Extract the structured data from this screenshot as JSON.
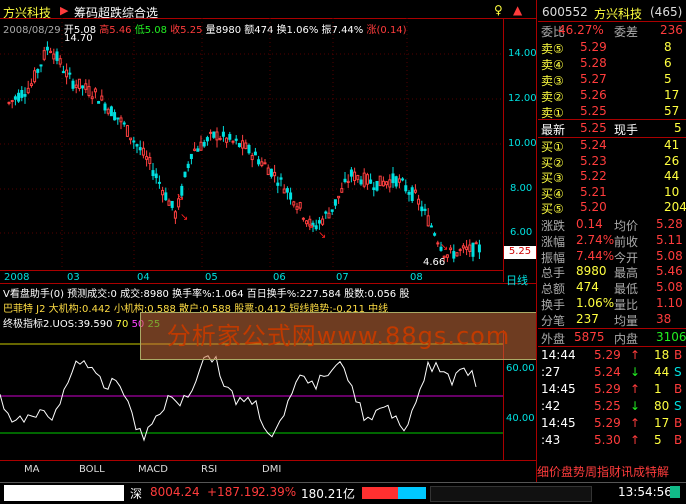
{
  "header": {
    "stock_name": "方兴科技",
    "indicator_name": "筹码超跌综合选",
    "date": "2008/08/29",
    "open": "开5.08",
    "high": "高5.46",
    "low": "低5.08",
    "close": "收5.25",
    "volume": "量8980",
    "amount": "额474",
    "turnover": "换1.06%",
    "amplitude": "振7.44%",
    "change": "涨(0.14)",
    "peak_label": "14.70"
  },
  "price_axis": [
    "14.00",
    "12.00",
    "10.00",
    "8.00",
    "6.00"
  ],
  "current_price_tag": "5.25",
  "low_label": "4.66",
  "date_axis": [
    "2008",
    "03",
    "04",
    "05",
    "06",
    "07",
    "08"
  ],
  "date_axis_right": "日线",
  "indicators": {
    "row1": "V看盘助手(0) 预测成交:0 成交:8980 换手率%:1.064 百日换手%:227.584 股数:0.056 股",
    "row2": "巴菲特 J2 大机构:0.442 小机构:0.588 散户:0.588 股票:0.412 短线趋势:-0.211 中线",
    "row3_prefix": "终极指标2.UOS:39.590",
    "row3_a": "70",
    "row3_b": "50",
    "row3_c": "25"
  },
  "osc_axis": [
    "60.00",
    "40.00"
  ],
  "watermark": "分析家公式网www.88gs.com",
  "tabs": [
    "MA",
    "BOLL",
    "MACD",
    "RSI",
    "DMI"
  ],
  "right_panel": {
    "code": "600552",
    "name": "方兴科技",
    "count": "(465)",
    "weibi_label": "委比",
    "weibi_value": "46.27%",
    "weicha_label": "委差",
    "weicha_value": "236",
    "sell": [
      {
        "label": "卖⑤",
        "price": "5.29",
        "vol": "8"
      },
      {
        "label": "卖④",
        "price": "5.28",
        "vol": "6"
      },
      {
        "label": "卖③",
        "price": "5.27",
        "vol": "5"
      },
      {
        "label": "卖②",
        "price": "5.26",
        "vol": "17"
      },
      {
        "label": "卖①",
        "price": "5.25",
        "vol": "57"
      }
    ],
    "latest_label": "最新",
    "latest_value": "5.25",
    "cur_hand_label": "现手",
    "cur_hand_value": "5",
    "buy": [
      {
        "label": "买①",
        "price": "5.24",
        "vol": "41"
      },
      {
        "label": "买②",
        "price": "5.23",
        "vol": "26"
      },
      {
        "label": "买③",
        "price": "5.22",
        "vol": "44"
      },
      {
        "label": "买④",
        "price": "5.21",
        "vol": "10"
      },
      {
        "label": "买⑤",
        "price": "5.20",
        "vol": "204"
      }
    ],
    "stats": [
      {
        "l1": "涨跌",
        "v1": "0.14",
        "l2": "均价",
        "v2": "5.28"
      },
      {
        "l1": "涨幅",
        "v1": "2.74%",
        "l2": "前收",
        "v2": "5.11"
      },
      {
        "l1": "振幅",
        "v1": "7.44%",
        "l2": "今开",
        "v2": "5.08"
      },
      {
        "l1": "总手",
        "v1": "8980",
        "l2": "最高",
        "v2": "5.46"
      },
      {
        "l1": "总额",
        "v1": "474",
        "l2": "最低",
        "v2": "5.08"
      },
      {
        "l1": "换手",
        "v1": "1.06%",
        "l2": "量比",
        "v2": "1.10"
      },
      {
        "l1": "分笔",
        "v1": "237",
        "l2": "均量",
        "v2": "38"
      }
    ],
    "outer_label": "外盘",
    "outer_value": "5875",
    "inner_label": "内盘",
    "inner_value": "3106",
    "ticks": [
      {
        "time": "14:44",
        "price": "5.29",
        "vol": "18",
        "dir": "B"
      },
      {
        "time": ":27",
        "price": "5.24",
        "vol": "44",
        "dir": "S"
      },
      {
        "time": "14:45",
        "price": "5.29",
        "vol": "1",
        "dir": "B"
      },
      {
        "time": ":42",
        "price": "5.25",
        "vol": "80",
        "dir": "S"
      },
      {
        "time": "14:45",
        "price": "5.29",
        "vol": "17",
        "dir": "B"
      },
      {
        "time": ":43",
        "price": "5.30",
        "vol": "5",
        "dir": "B"
      }
    ],
    "bottom_tabs": "细价盘势周指财讯成特解"
  },
  "status_bar": {
    "market": "深",
    "index": "8004.24",
    "change": "+187.19",
    "pct": "2.39%",
    "amount": "180.21亿",
    "time": "13:54:56"
  }
}
